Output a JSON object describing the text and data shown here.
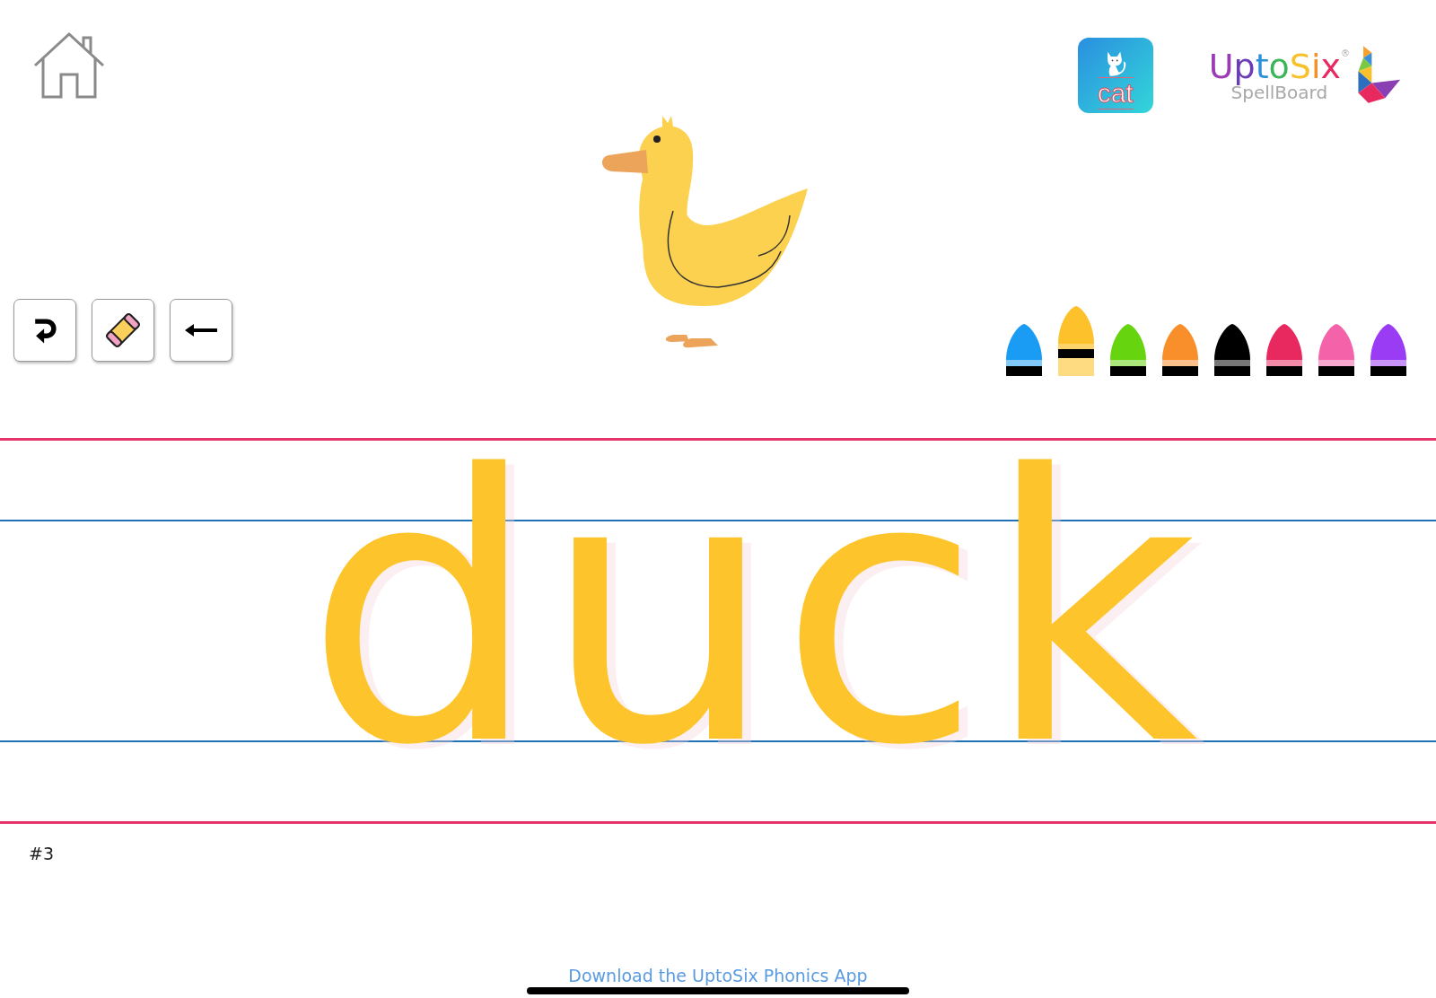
{
  "app_icon": {
    "label": "cat"
  },
  "logo": {
    "title": "UptoSix",
    "registered": "®",
    "subtitle": "SpellBoard"
  },
  "crayons": [
    {
      "color": "#1a9cf5",
      "selected": false
    },
    {
      "color": "#fdc22b",
      "selected": true
    },
    {
      "color": "#66d40e",
      "selected": false
    },
    {
      "color": "#f98f2a",
      "selected": false
    },
    {
      "color": "#000000",
      "selected": false
    },
    {
      "color": "#e8295f",
      "selected": false
    },
    {
      "color": "#f462a9",
      "selected": false
    },
    {
      "color": "#9b3cf5",
      "selected": false
    }
  ],
  "word": "duck",
  "page_number": "#3",
  "footer_link": "Download the UptoSix Phonics App"
}
